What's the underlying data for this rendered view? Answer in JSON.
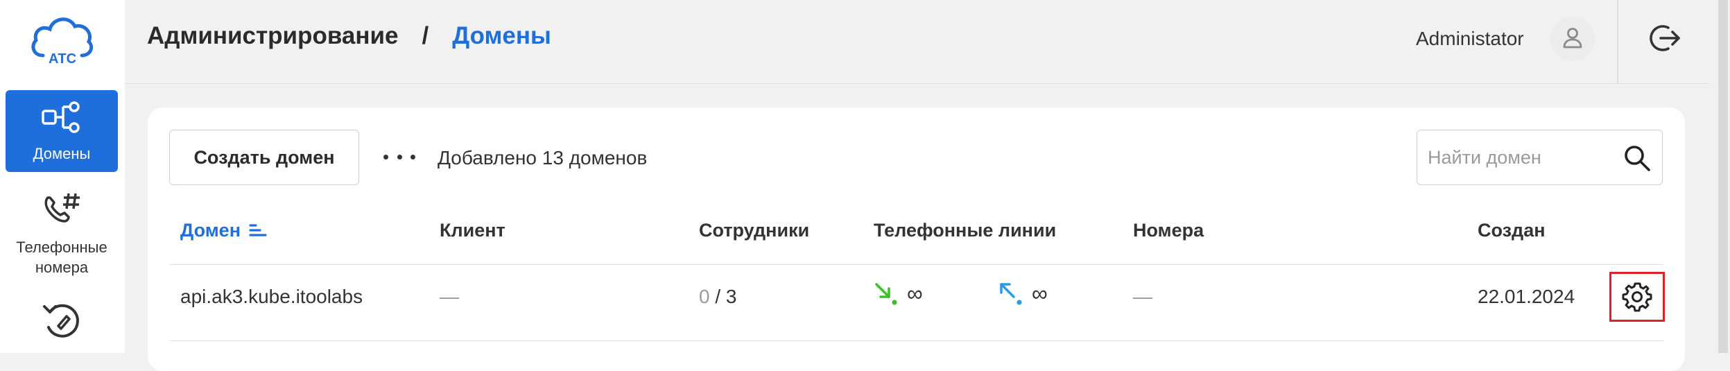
{
  "app": {
    "logo_text": "АТС"
  },
  "sidebar": {
    "items": [
      {
        "label": "Домены",
        "icon": "domains-icon",
        "active": true
      },
      {
        "label": "Телефонные номера",
        "icon": "phone-number-icon",
        "active": false
      },
      {
        "label": "",
        "icon": "history-icon",
        "active": false
      }
    ]
  },
  "header": {
    "breadcrumb_root": "Администрирование",
    "breadcrumb_separator": "/",
    "breadcrumb_current": "Домены",
    "user_name": "Administator"
  },
  "toolbar": {
    "create_label": "Создать домен",
    "added_count_text": "Добавлено 13 доменов",
    "search_placeholder": "Найти домен"
  },
  "table": {
    "columns": [
      "Домен",
      "Клиент",
      "Сотрудники",
      "Телефонные линии",
      "Номера",
      "Создан"
    ],
    "rows": [
      {
        "domain": "api.ak3.kube.itoolabs",
        "client": "—",
        "employees_active": "0",
        "employees_sep": " / ",
        "employees_total": "3",
        "lines_in": "∞",
        "lines_out": "∞",
        "numbers": "—",
        "created": "22.01.2024"
      }
    ]
  },
  "colors": {
    "accent": "#1e6fdc",
    "incoming": "#3fbf2a",
    "outgoing": "#2f9be6",
    "highlight": "#e01f26"
  }
}
